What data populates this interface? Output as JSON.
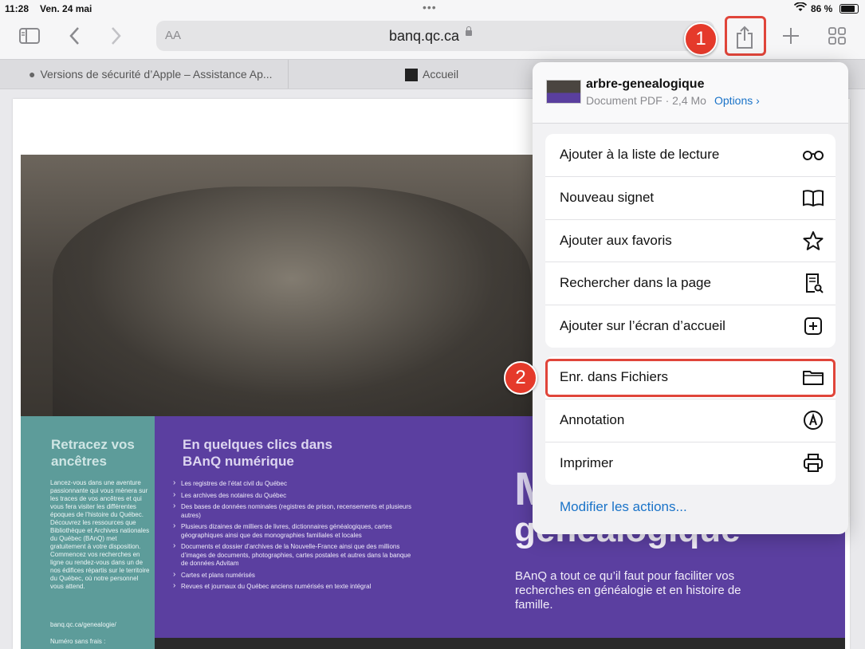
{
  "status_bar": {
    "time": "11:28",
    "date": "Ven. 24 mai",
    "battery": "86 %",
    "battery_level": 0.86
  },
  "toolbar": {
    "text_size": "AA",
    "url": "banq.qc.ca"
  },
  "tabs": [
    {
      "title": "Versions de sécurité d’Apple – Assistance Ap..."
    },
    {
      "title": "Accueil"
    }
  ],
  "badges": {
    "step1": "1",
    "step2": "2"
  },
  "share_sheet": {
    "doc_name": "arbre-genealogique",
    "doc_meta": "Document PDF · 2,4 Mo",
    "options": "Options ›",
    "actions": [
      {
        "label": "Ajouter à la liste de lecture",
        "icon": "glasses-icon"
      },
      {
        "label": "Nouveau signet",
        "icon": "book-icon"
      },
      {
        "label": "Ajouter aux favoris",
        "icon": "star-icon"
      },
      {
        "label": "Rechercher dans la page",
        "icon": "find-in-page-icon"
      },
      {
        "label": "Ajouter sur l’écran d’accueil",
        "icon": "add-square-icon"
      }
    ],
    "actions2": [
      {
        "label": "Enr. dans Fichiers",
        "icon": "folder-icon"
      },
      {
        "label": "Annotation",
        "icon": "markup-icon"
      },
      {
        "label": "Imprimer",
        "icon": "printer-icon"
      }
    ],
    "modify": "Modifier les actions..."
  },
  "document": {
    "teal_title": "Retracez vos ancêtres",
    "teal_text": "Lancez-vous dans une aventure passionnante qui vous mènera sur les traces de vos ancêtres et qui vous fera visiter les différentes époques de l’histoire du Québec. Découvrez les ressources que Bibliothèque et Archives nationales du Québec (BAnQ) met gratuitement à votre disposition. Commencez vos recherches en ligne ou rendez-vous dans un de nos édifices répartis sur le territoire du Québec, où notre personnel vous attend.",
    "teal_url": "banq.qc.ca/genealogie/",
    "teal_phone": "Numéro sans frais :",
    "purple_title": "En quelques clics dans BAnQ numérique",
    "bullets": [
      "Les registres de l’état civil du Québec",
      "Les archives des notaires du Québec",
      "Des bases de données nominales (registres de prison, recensements et plusieurs autres)",
      "Plusieurs dizaines de milliers de livres, dictionnaires généalogiques, cartes géographiques ainsi que des monographies familiales et locales",
      "Documents et dossier d’archives de la Nouvelle-France ainsi que des millions d’images de documents, photographies, cartes postales et autres dans la banque de données Advitam",
      "Cartes et plans numérisés",
      "Revues et journaux du Québec anciens numérisés en texte intégral"
    ],
    "big_m": "M",
    "big_gen": "généalogique",
    "description": "BAnQ a tout ce qu’il faut pour faciliter vos recherches en généalogie et en histoire de famille."
  }
}
